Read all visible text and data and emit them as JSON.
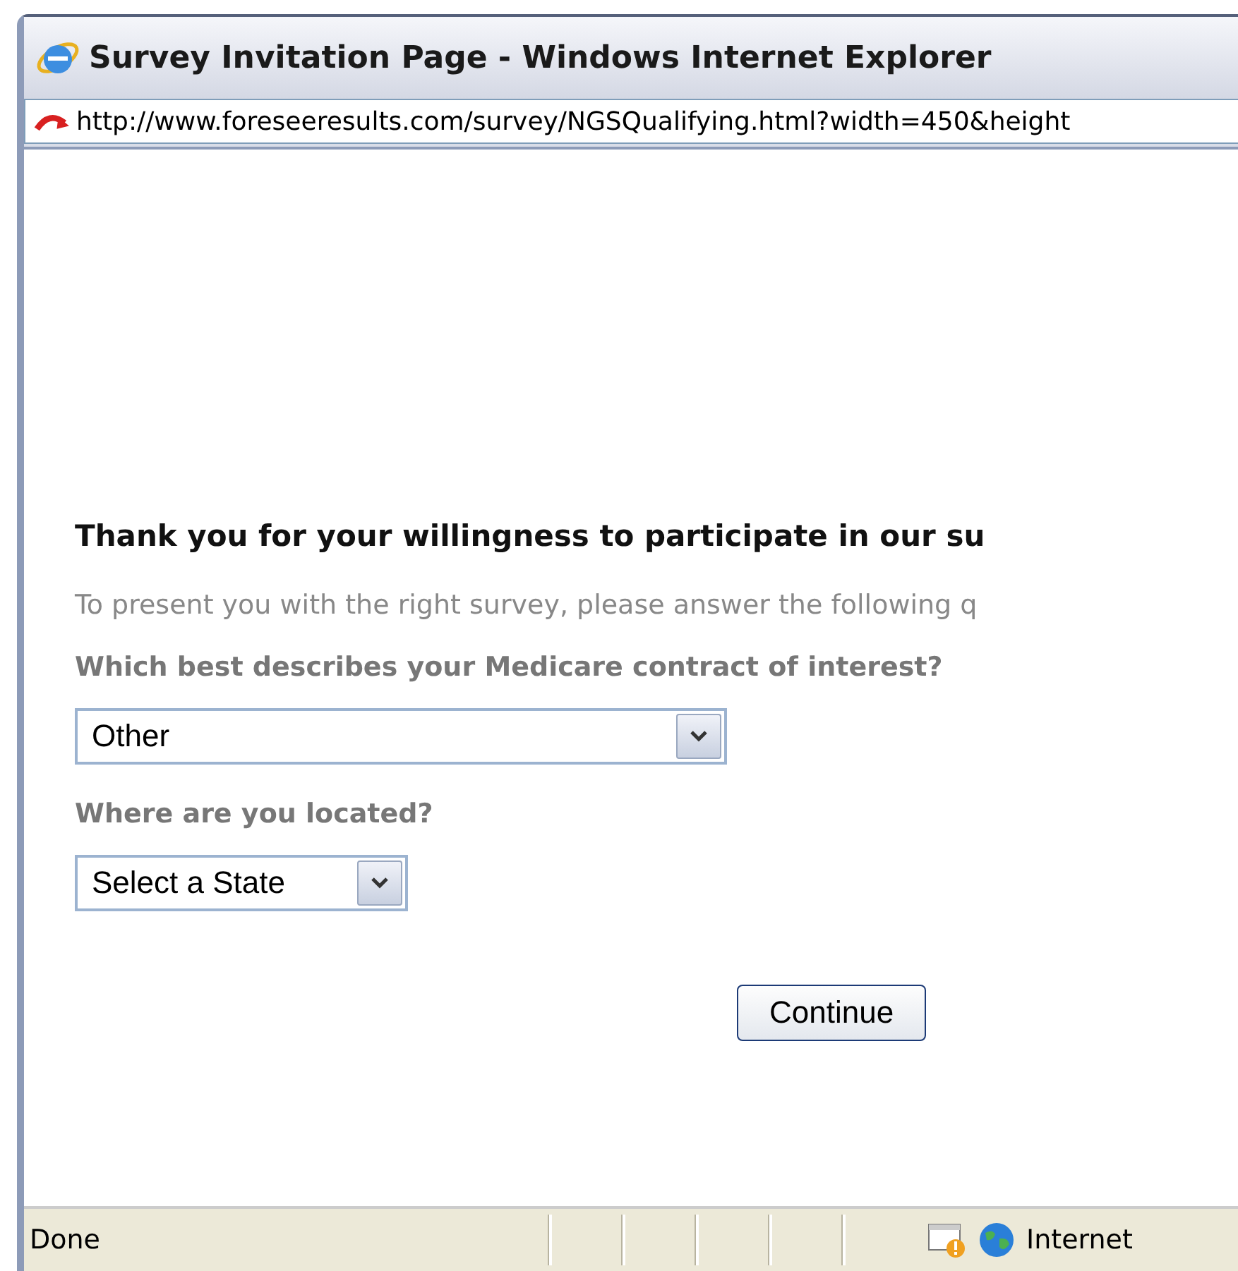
{
  "window": {
    "title": "Survey Invitation Page - Windows Internet Explorer"
  },
  "address_bar": {
    "url": "http://www.foreseeresults.com/survey/NGSQualifying.html?width=450&height"
  },
  "page": {
    "heading": "Thank you for your willingness to participate in our su",
    "intro": "To present you with the right survey, please answer the following q",
    "questions": [
      {
        "label": "Which best describes your Medicare contract of interest?",
        "value": "Other",
        "kind": "wide"
      },
      {
        "label": "Where are you located?",
        "value": "Select a State",
        "kind": "narrow"
      }
    ],
    "button": "Continue"
  },
  "status_bar": {
    "text": "Done",
    "zone": "Internet"
  }
}
